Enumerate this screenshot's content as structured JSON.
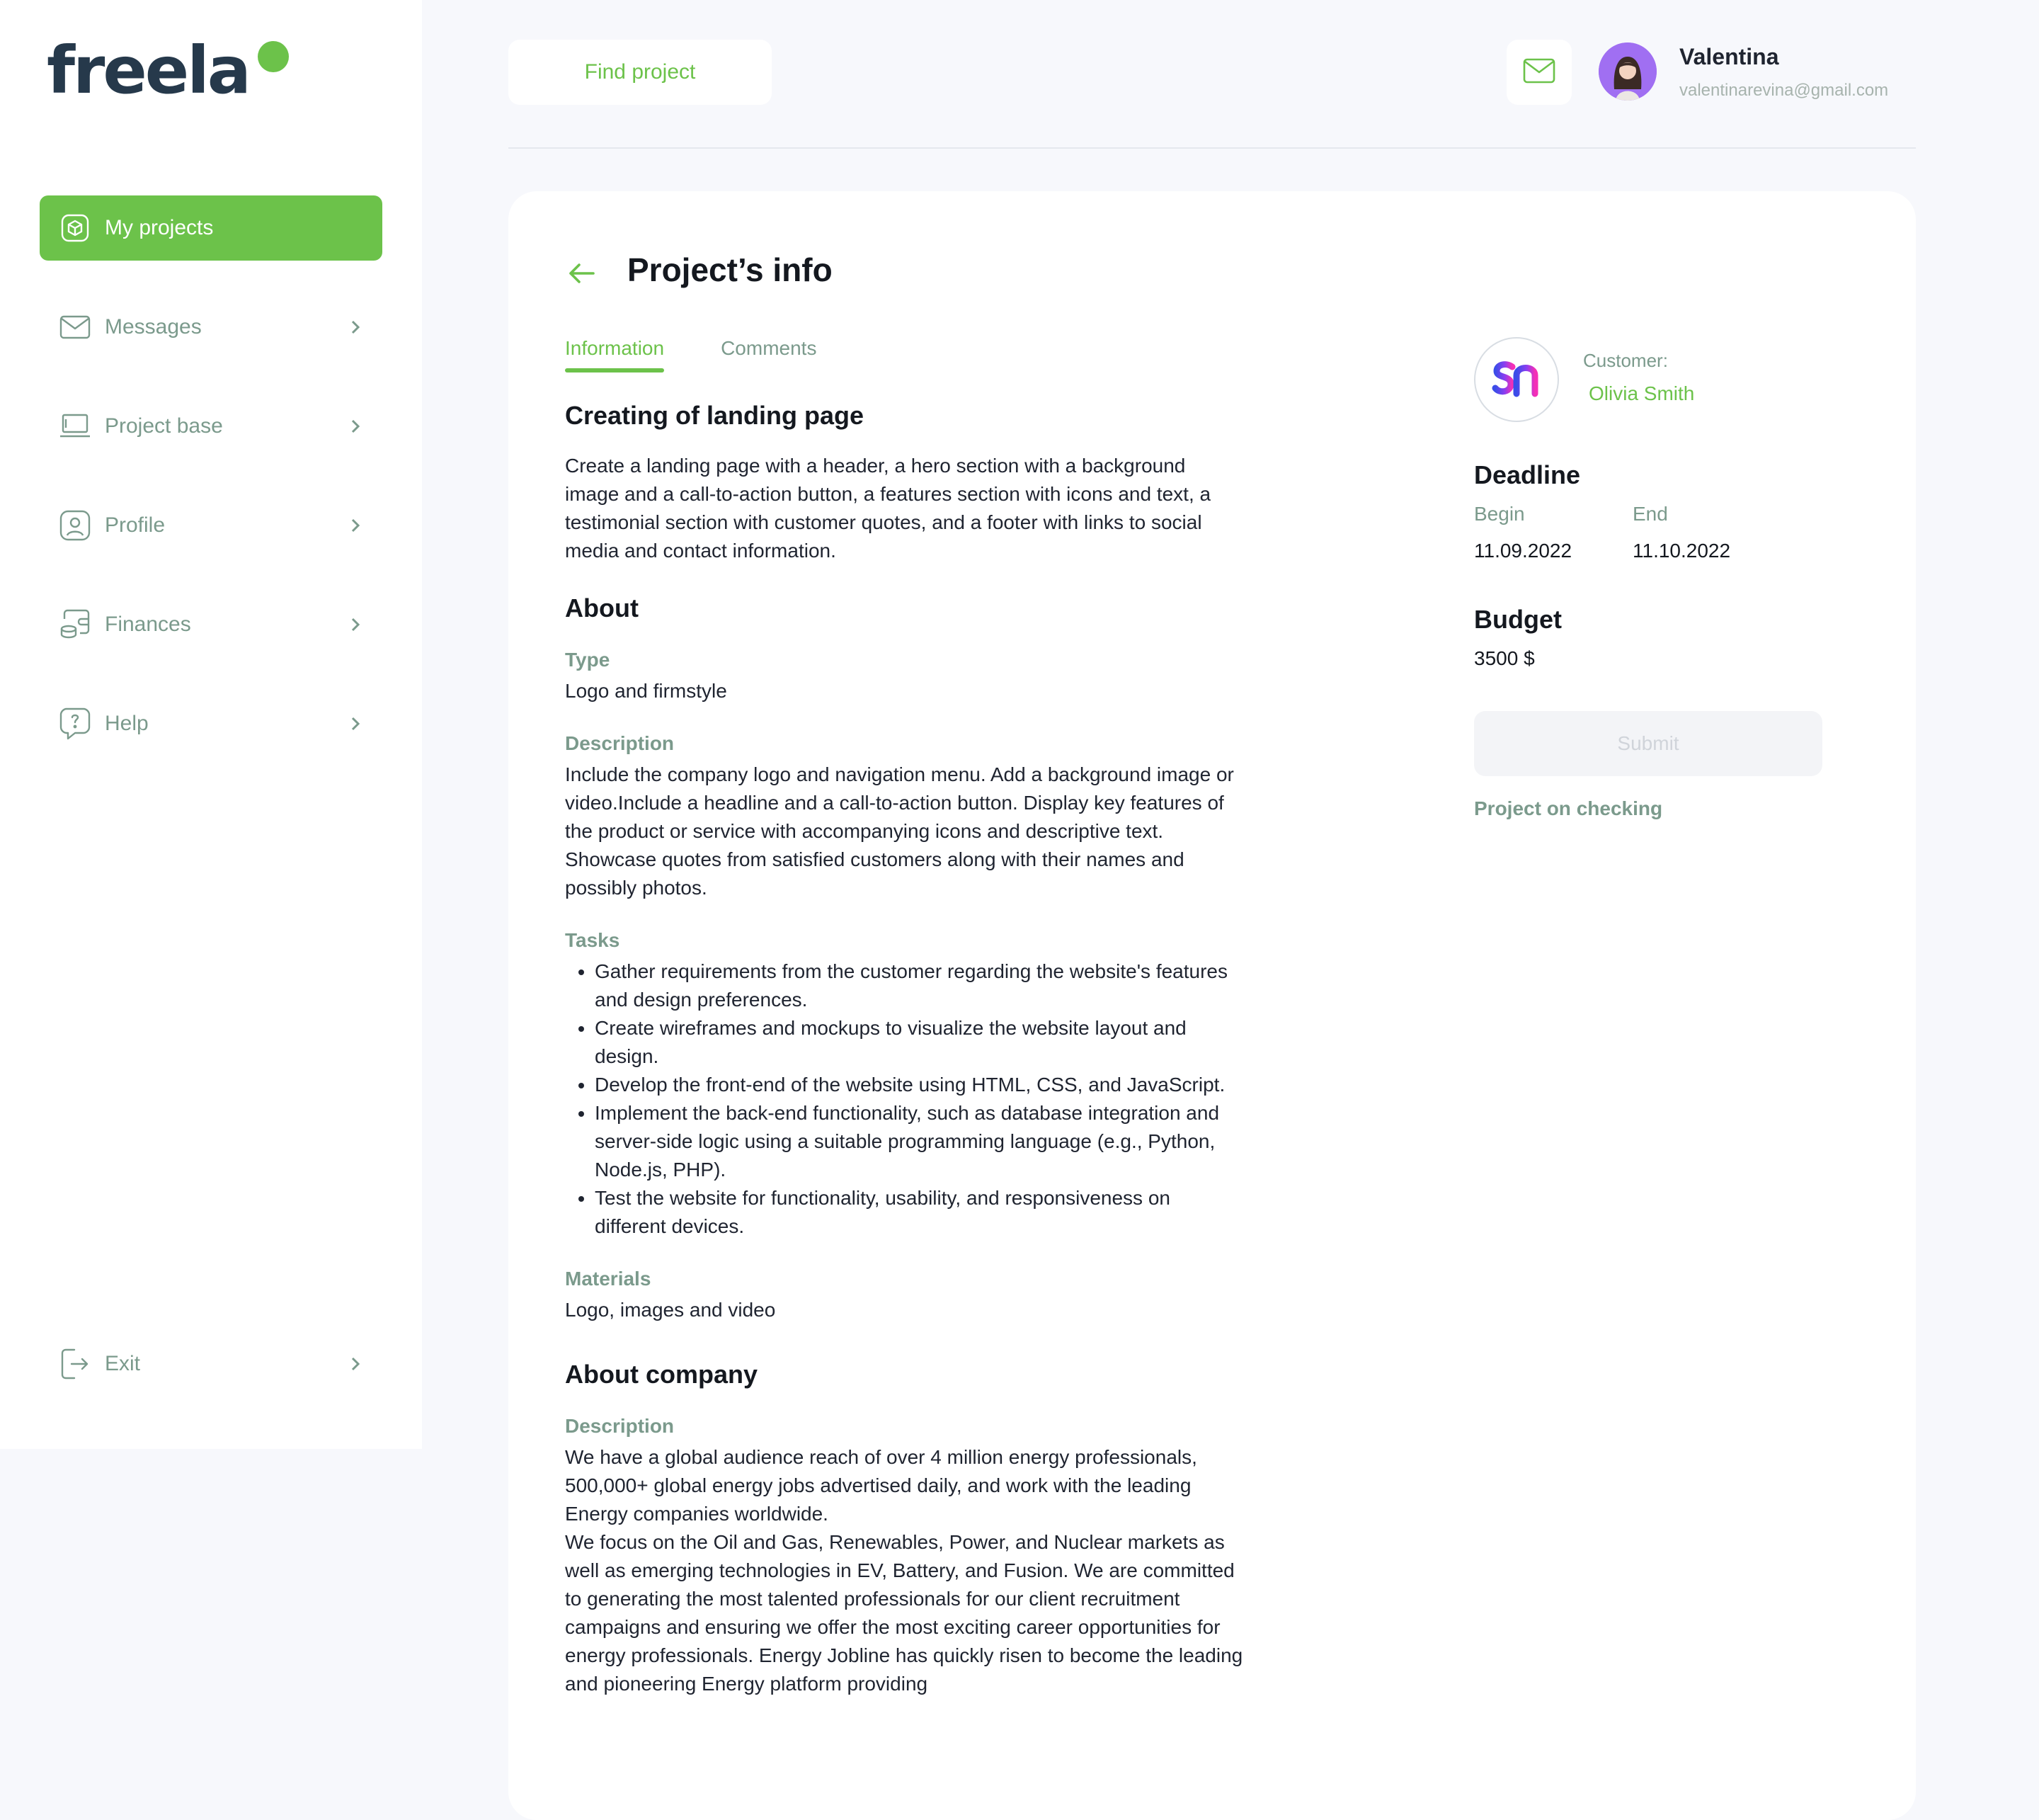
{
  "brand": {
    "logo_text": "freela",
    "accent": "#6cc24a",
    "dark": "#26394b"
  },
  "sidebar": {
    "items": [
      {
        "label": "My projects",
        "icon": "cube-icon",
        "active": true
      },
      {
        "label": "Messages",
        "icon": "mail-icon"
      },
      {
        "label": "Project base",
        "icon": "laptop-icon"
      },
      {
        "label": "Profile",
        "icon": "user-icon"
      },
      {
        "label": "Finances",
        "icon": "wallet-icon"
      },
      {
        "label": "Help",
        "icon": "help-icon"
      }
    ],
    "exit": {
      "label": "Exit",
      "icon": "exit-icon"
    }
  },
  "header": {
    "find_label": "Find project",
    "user_name": "Valentina",
    "user_email": "valentinarevina@gmail.com"
  },
  "card": {
    "title": "Project’s info",
    "tabs": [
      {
        "label": "Information"
      },
      {
        "label": "Comments"
      }
    ],
    "project_title": "Creating of landing page",
    "project_summary": "Create a landing page with a header, a hero section with a background image and a call-to-action button, a features section with icons and text, a testimonial section with customer quotes, and a footer with links to social media and contact information.",
    "about": {
      "heading": "About",
      "type_label": "Type",
      "type_value": "Logo and firmstyle",
      "desc_label": "Description",
      "desc_value": "Include the company logo and navigation menu. Add a background image or video.Include a headline and a call-to-action button. Display key features of the product or service with accompanying icons and descriptive text. Showcase quotes from satisfied customers along with their names and possibly photos.",
      "tasks_label": "Tasks",
      "tasks": [
        "Gather requirements from the customer regarding the website's features and design preferences.",
        "Create wireframes and mockups to visualize the website layout and design.",
        "Develop the front-end of the website using HTML, CSS, and JavaScript.",
        "Implement the back-end functionality, such as database integration and server-side logic using a suitable programming language (e.g., Python, Node.js, PHP).",
        "Test the website for functionality, usability, and responsiveness on different devices."
      ],
      "materials_label": "Materials",
      "materials_value": "Logo, images and video"
    },
    "company": {
      "heading": "About company",
      "desc_label": "Description",
      "desc_p1": "We have a global audience reach of over 4 million energy professionals, 500,000+  global energy jobs advertised daily, and work with the leading Energy companies worldwide.",
      "desc_p2": "We focus on the Oil and Gas, Renewables, Power, and Nuclear markets as well as emerging technologies in EV, Battery, and Fusion. We are committed to generating the most talented professionals for our client recruitment campaigns and ensuring we offer the most exciting career opportunities for energy professionals. Energy Jobline has quickly risen to become the leading and pioneering Energy platform providing"
    },
    "customer": {
      "label": "Customer:",
      "name": "Olivia Smith",
      "logo_icon": "sn-logo-icon"
    },
    "deadline": {
      "heading": "Deadline",
      "begin_label": "Begin",
      "end_label": "End",
      "begin": "11.09.2022",
      "end": "11.10.2022"
    },
    "budget": {
      "heading": "Budget",
      "value": "3500 $"
    },
    "submit_label": "Submit",
    "status": "Project on checking"
  }
}
